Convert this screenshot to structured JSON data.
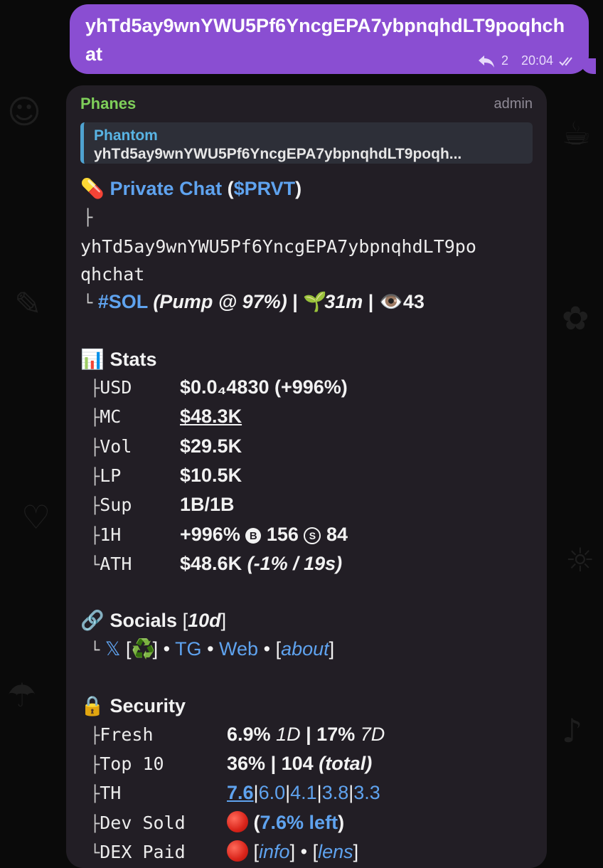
{
  "outgoing": {
    "text": "yhTd5ay9wnYWU5Pf6YncgEPA7ybpnqhdLT9poqhchat",
    "reply_count": "2",
    "time": "20:04"
  },
  "incoming": {
    "sender": "Phanes",
    "role": "admin",
    "reply_to": {
      "name": "Phantom",
      "text": "yhTd5ay9wnYWU5Pf6YncgEPA7ybpnqhdLT9poqh..."
    },
    "header": {
      "emoji": "💊",
      "token_name": "Private Chat",
      "open": " (",
      "ticker": "$PRVT",
      "close": ")",
      "branch": "├",
      "address_line1": "yhTd5ay9wnYWU5Pf6YncgEPA7ybpnqhdLT9po",
      "address_line2": "qhchat",
      "end": "└",
      "chain": "#SOL",
      "pump": "(Pump @ ",
      "pump_pct": "97%",
      "pump_close": ")",
      "sep": " | ",
      "age_emoji": "🌱",
      "age": "31m",
      "eye_emoji": "👁️",
      "views": "43"
    },
    "stats": {
      "emoji": "📊",
      "title": "Stats",
      "rows": [
        {
          "branch": "├",
          "label": "USD",
          "value": "$0.0₄4830 (+996%)"
        },
        {
          "branch": "├",
          "label": "MC",
          "value": "$48.3K"
        },
        {
          "branch": "├",
          "label": "Vol",
          "value": "$29.5K"
        },
        {
          "branch": "├",
          "label": "LP",
          "value": "$10.5K"
        },
        {
          "branch": "├",
          "label": "Sup",
          "value": "1B/1B"
        },
        {
          "branch": "├",
          "label": "1H",
          "value": "+996%",
          "buy_icon": "B",
          "buys": "156",
          "sell_icon": "S",
          "sells": "84"
        },
        {
          "branch": "└",
          "label": "ATH",
          "value": "$48.6K",
          "extra": "(-1% / 19s)"
        }
      ]
    },
    "socials": {
      "emoji": "🔗",
      "title": "Socials",
      "age_open": "[",
      "age": "10d",
      "age_close": "]",
      "branch": "└",
      "x": "𝕏",
      "x_badge_open": "[",
      "x_badge": "♻️",
      "x_badge_close": "]",
      "dot": "•",
      "tg": "TG",
      "web": "Web",
      "about_open": "[",
      "about": "about",
      "about_close": "]"
    },
    "security": {
      "emoji": "🔒",
      "title": "Security",
      "fresh": {
        "branch": "├",
        "label": "Fresh",
        "v1": "6.9%",
        "v1_tag": "1D",
        "sep": "|",
        "v2": "17%",
        "v2_tag": "7D"
      },
      "top10": {
        "branch": "├",
        "label": "Top 10",
        "v1": "36%",
        "sep": "|",
        "v2": "104",
        "v2_tag": "(total)"
      },
      "th": {
        "branch": "├",
        "label": "TH",
        "values": [
          "7.6",
          "6.0",
          "4.1",
          "3.8",
          "3.3"
        ],
        "sep": "|"
      },
      "dev_sold": {
        "branch": "├",
        "label": "Dev Sold",
        "open": "(",
        "left": "7.6% left",
        "close": ")"
      },
      "dex_paid": {
        "branch": "└",
        "label": "DEX Paid",
        "info_open": "[",
        "info": "info",
        "info_close": "]",
        "dot": "•",
        "lens_open": "[",
        "lens": "lens",
        "lens_close": "]"
      }
    }
  }
}
